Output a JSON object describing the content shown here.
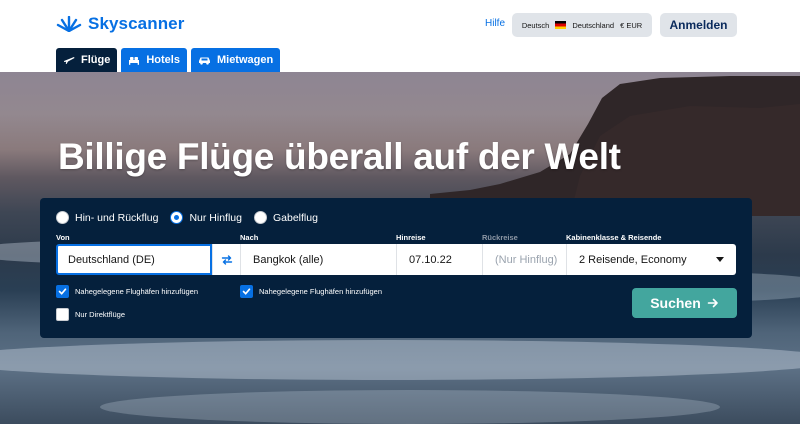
{
  "header": {
    "logo_text": "Skyscanner",
    "help": "Hilfe",
    "locale": {
      "language": "Deutsch",
      "country": "Deutschland",
      "currency": "€ EUR"
    },
    "login": "Anmelden"
  },
  "tabs": [
    {
      "label": "Flüge",
      "icon": "plane-icon",
      "active": true
    },
    {
      "label": "Hotels",
      "icon": "bed-icon",
      "active": false
    },
    {
      "label": "Mietwagen",
      "icon": "car-icon",
      "active": false
    }
  ],
  "hero": {
    "headline": "Billige Flüge überall auf der Welt"
  },
  "search": {
    "trip_types": [
      {
        "label": "Hin- und Rückflug",
        "checked": false
      },
      {
        "label": "Nur Hinflug",
        "checked": true
      },
      {
        "label": "Gabelflug",
        "checked": false
      }
    ],
    "from": {
      "label": "Von",
      "value": "Deutschland (DE)"
    },
    "to": {
      "label": "Nach",
      "value": "Bangkok (alle)"
    },
    "depart": {
      "label": "Hinreise",
      "value": "07.10.22"
    },
    "return": {
      "label": "Rückreise",
      "placeholder": "(Nur Hinflug)"
    },
    "cabin": {
      "label": "Kabinenklasse & Reisende",
      "value": "2 Reisende, Economy"
    },
    "nearby_from": {
      "label": "Nahegelegene Flughäfen hinzufügen",
      "checked": true
    },
    "nearby_to": {
      "label": "Nahegelegene Flughäfen hinzufügen",
      "checked": true
    },
    "direct_only": {
      "label": "Nur Direktflüge",
      "checked": false
    },
    "submit": "Suchen"
  },
  "colors": {
    "brand_blue": "#0770e3",
    "navy": "#05203c",
    "search_green": "#43a69e"
  }
}
